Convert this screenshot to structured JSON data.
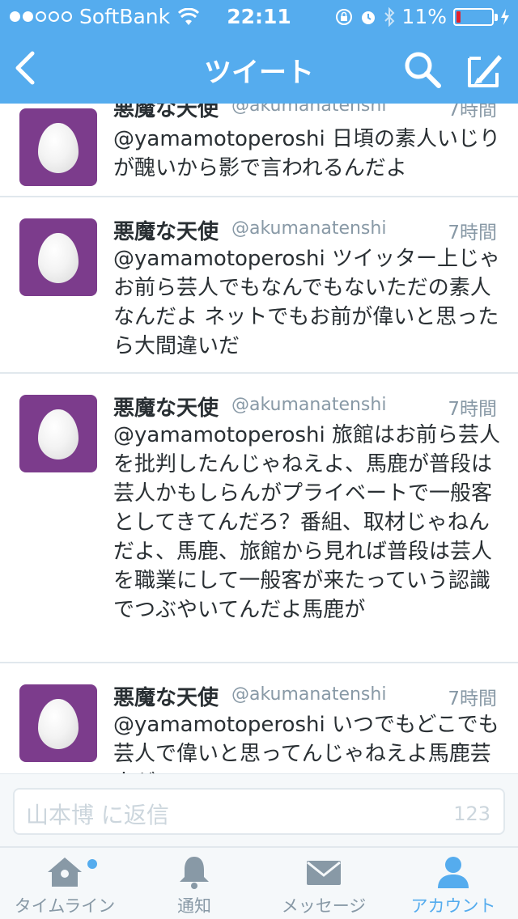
{
  "status_bar": {
    "carrier": "SoftBank",
    "time": "22:11",
    "battery": "11%",
    "battery_level": 0.11,
    "signal_dots_on": 2,
    "signal_dots_total": 5
  },
  "nav": {
    "title": "ツイート",
    "back_icon": "chevron-left-icon",
    "search_icon": "search-icon",
    "compose_icon": "compose-icon"
  },
  "tweets": [
    {
      "name": "悪魔な天使",
      "handle": "@akumanatenshi",
      "time": "7時間",
      "text": "@yamamotoperoshi 日頃の素人いじりが醜いから影で言われるんだよ"
    },
    {
      "name": "悪魔な天使",
      "handle": "@akumanatenshi",
      "time": "7時間",
      "text": "@yamamotoperoshi ツイッター上じゃお前ら芸人でもなんでもないただの素人なんだよ ネットでもお前が偉いと思ったら大間違いだ"
    },
    {
      "name": "悪魔な天使",
      "handle": "@akumanatenshi",
      "time": "7時間",
      "text": "@yamamotoperoshi 旅館はお前ら芸人を批判したんじゃねえよ、馬鹿が普段は芸人かもしらんがプライベートで一般客としてきてんだろ？番組、取材じゃねんだよ、馬鹿、旅館から見れば普段は芸人を職業にして一般客が来たっていう認識でつぶやいてんだよ馬鹿が"
    },
    {
      "name": "悪魔な天使",
      "handle": "@akumanatenshi",
      "time": "7時間",
      "text": "@yamamotoperoshi いつでもどこでも芸人で偉いと思ってんじゃねえよ馬鹿芸人が"
    }
  ],
  "reply": {
    "placeholder": "山本博 に返信",
    "counter": "123"
  },
  "tabs": [
    {
      "label": "タイムライン",
      "icon": "home-icon",
      "active": false,
      "has_dot": true
    },
    {
      "label": "通知",
      "icon": "bell-icon",
      "active": false,
      "has_dot": false
    },
    {
      "label": "メッセージ",
      "icon": "envelope-icon",
      "active": false,
      "has_dot": false
    },
    {
      "label": "アカウント",
      "icon": "person-icon",
      "active": true,
      "has_dot": false
    }
  ],
  "colors": {
    "brand": "#55acee",
    "avatar_bg": "#7c3c8c",
    "battery_low": "#e3202d"
  }
}
